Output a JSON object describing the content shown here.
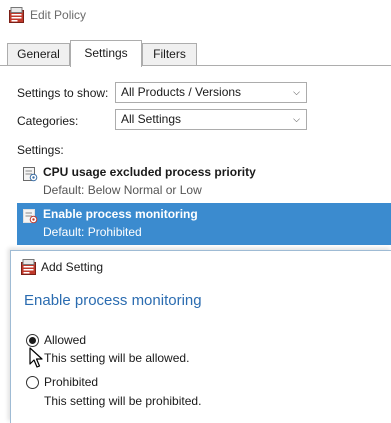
{
  "window": {
    "title": "Edit Policy",
    "icon": "policy-icon"
  },
  "tabs": [
    {
      "label": "General",
      "active": false
    },
    {
      "label": "Settings",
      "active": true
    },
    {
      "label": "Filters",
      "active": false
    }
  ],
  "filters": {
    "settings_to_show_label": "Settings to show:",
    "settings_to_show_value": "All Products / Versions",
    "categories_label": "Categories:",
    "categories_value": "All Settings"
  },
  "settings_list": {
    "label": "Settings:",
    "items": [
      {
        "title": "CPU usage excluded process priority",
        "default": "Default: Below Normal or Low",
        "selected": false,
        "icon": "setting-icon"
      },
      {
        "title": "Enable process monitoring",
        "default": "Default: Prohibited",
        "selected": true,
        "icon": "setting-icon"
      }
    ]
  },
  "dialog": {
    "title": "Add Setting",
    "icon": "policy-icon",
    "heading": "Enable process monitoring",
    "options": [
      {
        "label": "Allowed",
        "description": "This setting will be allowed.",
        "checked": true
      },
      {
        "label": "Prohibited",
        "description": "This setting will be prohibited.",
        "checked": false
      }
    ]
  },
  "colors": {
    "selection": "#3b8bcf",
    "heading": "#2b6cb0"
  }
}
